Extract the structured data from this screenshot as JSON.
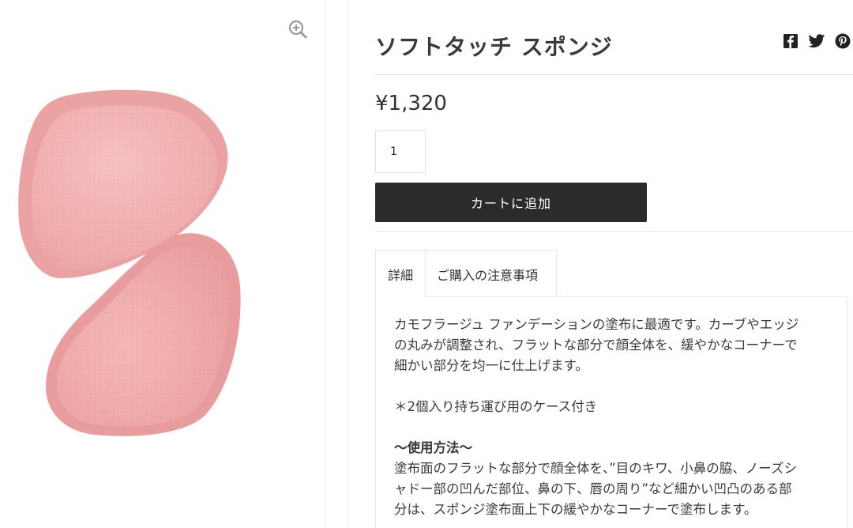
{
  "gallery": {
    "zoom_icon": "zoom-in-icon",
    "image": "pink-makeup-sponges"
  },
  "product": {
    "title": "ソフトタッチ スポンジ",
    "price": "¥1,320",
    "quantity": "1",
    "add_to_cart_label": "カートに追加"
  },
  "share": {
    "icons": [
      "facebook-icon",
      "twitter-icon",
      "pinterest-icon"
    ]
  },
  "tabs": {
    "detail_label": "詳細",
    "notes_label": "ご購入の注意事項"
  },
  "description": {
    "intro_line1": "カモフラージュ ファンデーションの塗布に最適です。カーブやエッジ",
    "intro_line2": "の丸みが調整され、フラットな部分で顔全体を、緩やかなコーナーで",
    "intro_line3": "細かい部分を均一に仕上げます。",
    "case_note": "＊2個入り持ち運び用のケース付き",
    "howto_heading": "〜使用方法〜",
    "howto_line1": "塗布面のフラットな部分で顔全体を、”目のキワ、小鼻の脇、ノーズシ",
    "howto_line2": "ャドー部の凹んだ部位、鼻の下、唇の周り”など細かい凹凸のある部",
    "howto_line3": "分は、スポンジ塗布面上下の緩やかなコーナーで塗布します。"
  },
  "colors": {
    "button_bg": "#2b2b2b",
    "sponge_pink": "#f3b3b3",
    "border": "#e6e6e6"
  }
}
